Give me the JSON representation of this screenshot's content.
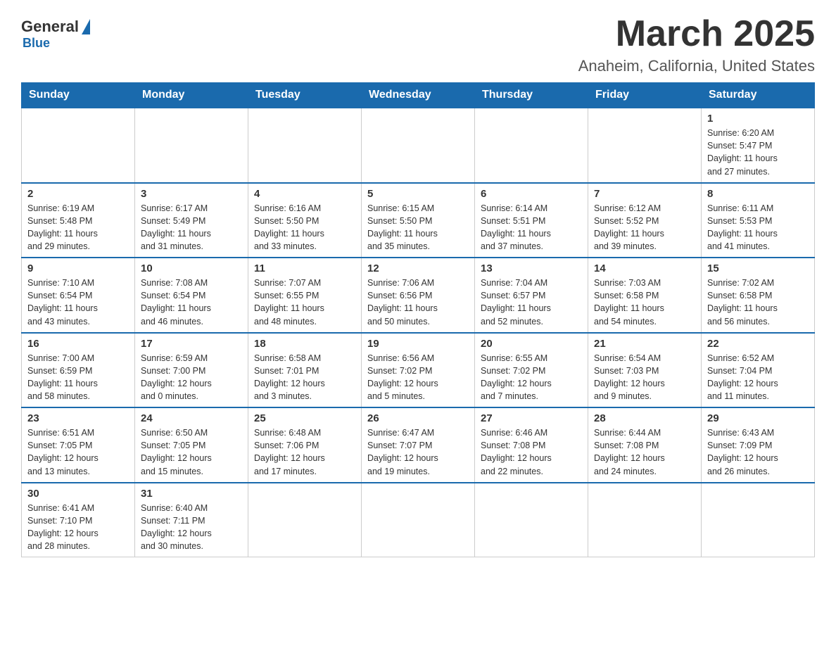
{
  "header": {
    "logo_general": "General",
    "logo_blue": "Blue",
    "title": "March 2025",
    "subtitle": "Anaheim, California, United States"
  },
  "weekdays": [
    "Sunday",
    "Monday",
    "Tuesday",
    "Wednesday",
    "Thursday",
    "Friday",
    "Saturday"
  ],
  "weeks": [
    [
      {
        "day": "",
        "info": ""
      },
      {
        "day": "",
        "info": ""
      },
      {
        "day": "",
        "info": ""
      },
      {
        "day": "",
        "info": ""
      },
      {
        "day": "",
        "info": ""
      },
      {
        "day": "",
        "info": ""
      },
      {
        "day": "1",
        "info": "Sunrise: 6:20 AM\nSunset: 5:47 PM\nDaylight: 11 hours\nand 27 minutes."
      }
    ],
    [
      {
        "day": "2",
        "info": "Sunrise: 6:19 AM\nSunset: 5:48 PM\nDaylight: 11 hours\nand 29 minutes."
      },
      {
        "day": "3",
        "info": "Sunrise: 6:17 AM\nSunset: 5:49 PM\nDaylight: 11 hours\nand 31 minutes."
      },
      {
        "day": "4",
        "info": "Sunrise: 6:16 AM\nSunset: 5:50 PM\nDaylight: 11 hours\nand 33 minutes."
      },
      {
        "day": "5",
        "info": "Sunrise: 6:15 AM\nSunset: 5:50 PM\nDaylight: 11 hours\nand 35 minutes."
      },
      {
        "day": "6",
        "info": "Sunrise: 6:14 AM\nSunset: 5:51 PM\nDaylight: 11 hours\nand 37 minutes."
      },
      {
        "day": "7",
        "info": "Sunrise: 6:12 AM\nSunset: 5:52 PM\nDaylight: 11 hours\nand 39 minutes."
      },
      {
        "day": "8",
        "info": "Sunrise: 6:11 AM\nSunset: 5:53 PM\nDaylight: 11 hours\nand 41 minutes."
      }
    ],
    [
      {
        "day": "9",
        "info": "Sunrise: 7:10 AM\nSunset: 6:54 PM\nDaylight: 11 hours\nand 43 minutes."
      },
      {
        "day": "10",
        "info": "Sunrise: 7:08 AM\nSunset: 6:54 PM\nDaylight: 11 hours\nand 46 minutes."
      },
      {
        "day": "11",
        "info": "Sunrise: 7:07 AM\nSunset: 6:55 PM\nDaylight: 11 hours\nand 48 minutes."
      },
      {
        "day": "12",
        "info": "Sunrise: 7:06 AM\nSunset: 6:56 PM\nDaylight: 11 hours\nand 50 minutes."
      },
      {
        "day": "13",
        "info": "Sunrise: 7:04 AM\nSunset: 6:57 PM\nDaylight: 11 hours\nand 52 minutes."
      },
      {
        "day": "14",
        "info": "Sunrise: 7:03 AM\nSunset: 6:58 PM\nDaylight: 11 hours\nand 54 minutes."
      },
      {
        "day": "15",
        "info": "Sunrise: 7:02 AM\nSunset: 6:58 PM\nDaylight: 11 hours\nand 56 minutes."
      }
    ],
    [
      {
        "day": "16",
        "info": "Sunrise: 7:00 AM\nSunset: 6:59 PM\nDaylight: 11 hours\nand 58 minutes."
      },
      {
        "day": "17",
        "info": "Sunrise: 6:59 AM\nSunset: 7:00 PM\nDaylight: 12 hours\nand 0 minutes."
      },
      {
        "day": "18",
        "info": "Sunrise: 6:58 AM\nSunset: 7:01 PM\nDaylight: 12 hours\nand 3 minutes."
      },
      {
        "day": "19",
        "info": "Sunrise: 6:56 AM\nSunset: 7:02 PM\nDaylight: 12 hours\nand 5 minutes."
      },
      {
        "day": "20",
        "info": "Sunrise: 6:55 AM\nSunset: 7:02 PM\nDaylight: 12 hours\nand 7 minutes."
      },
      {
        "day": "21",
        "info": "Sunrise: 6:54 AM\nSunset: 7:03 PM\nDaylight: 12 hours\nand 9 minutes."
      },
      {
        "day": "22",
        "info": "Sunrise: 6:52 AM\nSunset: 7:04 PM\nDaylight: 12 hours\nand 11 minutes."
      }
    ],
    [
      {
        "day": "23",
        "info": "Sunrise: 6:51 AM\nSunset: 7:05 PM\nDaylight: 12 hours\nand 13 minutes."
      },
      {
        "day": "24",
        "info": "Sunrise: 6:50 AM\nSunset: 7:05 PM\nDaylight: 12 hours\nand 15 minutes."
      },
      {
        "day": "25",
        "info": "Sunrise: 6:48 AM\nSunset: 7:06 PM\nDaylight: 12 hours\nand 17 minutes."
      },
      {
        "day": "26",
        "info": "Sunrise: 6:47 AM\nSunset: 7:07 PM\nDaylight: 12 hours\nand 19 minutes."
      },
      {
        "day": "27",
        "info": "Sunrise: 6:46 AM\nSunset: 7:08 PM\nDaylight: 12 hours\nand 22 minutes."
      },
      {
        "day": "28",
        "info": "Sunrise: 6:44 AM\nSunset: 7:08 PM\nDaylight: 12 hours\nand 24 minutes."
      },
      {
        "day": "29",
        "info": "Sunrise: 6:43 AM\nSunset: 7:09 PM\nDaylight: 12 hours\nand 26 minutes."
      }
    ],
    [
      {
        "day": "30",
        "info": "Sunrise: 6:41 AM\nSunset: 7:10 PM\nDaylight: 12 hours\nand 28 minutes."
      },
      {
        "day": "31",
        "info": "Sunrise: 6:40 AM\nSunset: 7:11 PM\nDaylight: 12 hours\nand 30 minutes."
      },
      {
        "day": "",
        "info": ""
      },
      {
        "day": "",
        "info": ""
      },
      {
        "day": "",
        "info": ""
      },
      {
        "day": "",
        "info": ""
      },
      {
        "day": "",
        "info": ""
      }
    ]
  ]
}
